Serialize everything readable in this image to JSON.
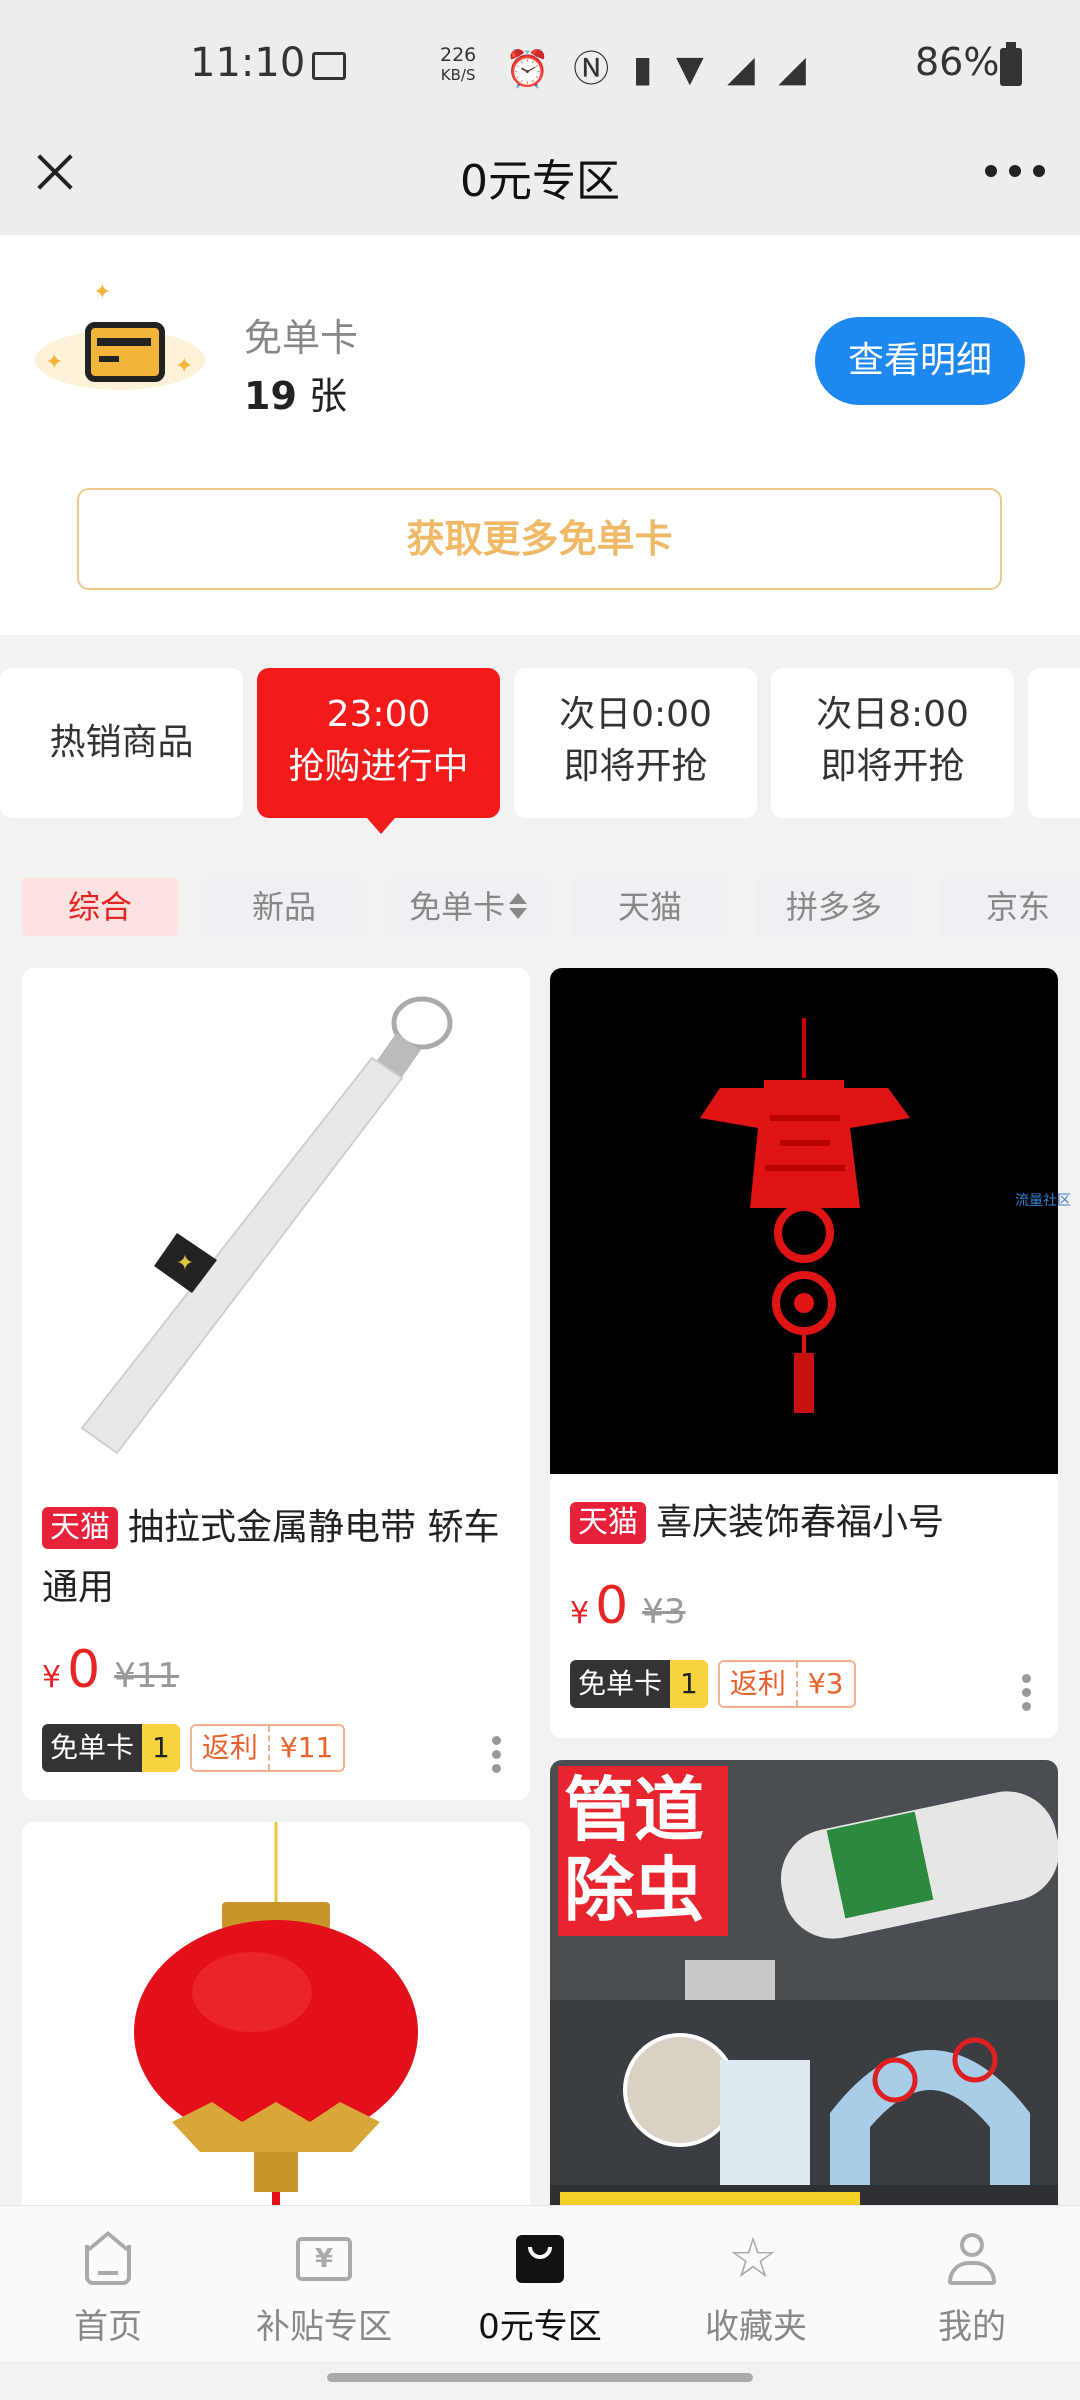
{
  "status_bar": {
    "time": "11:10",
    "net_speed_value": "226",
    "net_speed_unit": "KB/S",
    "icons_text": "⏰ Ⓝ ▮ ▼ ◢ ◢",
    "battery": "86%"
  },
  "header": {
    "title": "0元专区"
  },
  "card_section": {
    "label": "免单卡",
    "count": "19",
    "unit": "张",
    "detail_button": "查看明细",
    "more_cards_button": "获取更多免单卡"
  },
  "time_tabs": [
    {
      "label": "热销商品"
    },
    {
      "line1": "23:00",
      "line2": "抢购进行中"
    },
    {
      "line1": "次日0:00",
      "line2": "即将开抢"
    },
    {
      "line1": "次日8:00",
      "line2": "即将开抢"
    }
  ],
  "filters": [
    {
      "label": "综合"
    },
    {
      "label": "新品"
    },
    {
      "label": "免单卡"
    },
    {
      "label": "天猫"
    },
    {
      "label": "拼多多"
    },
    {
      "label": "京东"
    }
  ],
  "products": [
    {
      "store_tag": "天猫",
      "name": "抽拉式金属静电带 轿车通用",
      "currency": "¥",
      "price": "0",
      "original_price": "¥11",
      "free_card_label": "免单卡",
      "free_card_count": "1",
      "rebate_label": "返利",
      "rebate_value": "¥11"
    },
    {
      "store_tag": "天猫",
      "name": "喜庆装饰春福小号",
      "currency": "¥",
      "price": "0",
      "original_price": "¥3",
      "free_card_label": "免单卡",
      "free_card_count": "1",
      "rebate_label": "返利",
      "rebate_value": "¥3"
    }
  ],
  "promo_image_text": {
    "line1": "管道",
    "line2": "除虫"
  },
  "side_watermark": "流量社区",
  "bottom_nav": [
    {
      "label": "首页",
      "icon": "home-icon"
    },
    {
      "label": "补贴专区",
      "icon": "yen-ticket-icon"
    },
    {
      "label": "0元专区",
      "icon": "shopping-bag-icon"
    },
    {
      "label": "收藏夹",
      "icon": "star-icon"
    },
    {
      "label": "我的",
      "icon": "user-icon"
    }
  ],
  "colors": {
    "accent_red": "#f31a1a",
    "button_blue": "#1d88f0",
    "gold": "#f0b968"
  }
}
